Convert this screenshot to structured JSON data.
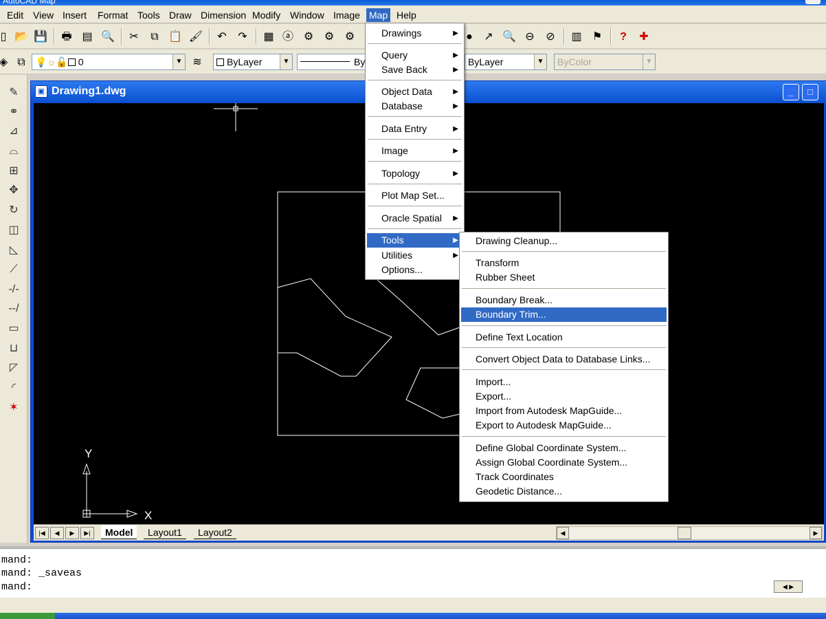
{
  "window": {
    "title": "AutoCAD Map"
  },
  "menubar": {
    "items": [
      "Edit",
      "View",
      "Insert",
      "Format",
      "Tools",
      "Draw",
      "Dimension",
      "Modify",
      "Window",
      "Image",
      "Map",
      "Help"
    ],
    "active": "Map"
  },
  "properties_toolbar": {
    "layer_value": "0",
    "color_value": "ByLayer",
    "linetype_value": "ByLayer",
    "lineweight_value": "ByLayer",
    "plotstyle_value": "ByColor"
  },
  "drawing": {
    "title": "Drawing1.dwg",
    "ucs": {
      "x_label": "X",
      "y_label": "Y"
    },
    "tabs": [
      "Model",
      "Layout1",
      "Layout2"
    ],
    "active_tab": "Model"
  },
  "command": {
    "lines": [
      "mand:",
      "mand: _saveas",
      "mand:"
    ]
  },
  "map_menu": {
    "items": [
      {
        "label": "Drawings",
        "submenu": true
      },
      {
        "label": "Query",
        "submenu": true
      },
      {
        "label": "Save Back",
        "submenu": true
      },
      {
        "label": "Object Data",
        "submenu": true
      },
      {
        "label": "Database",
        "submenu": true
      },
      {
        "label": "Data Entry",
        "submenu": true
      },
      {
        "label": "Image",
        "submenu": true
      },
      {
        "label": "Topology",
        "submenu": true
      },
      {
        "label": "Plot Map Set...",
        "submenu": false
      },
      {
        "label": "Oracle Spatial",
        "submenu": true
      },
      {
        "label": "Tools",
        "submenu": true,
        "highlighted": true
      },
      {
        "label": "Utilities",
        "submenu": true
      },
      {
        "label": "Options...",
        "submenu": false
      }
    ]
  },
  "tools_submenu": {
    "items": [
      {
        "label": "Drawing Cleanup..."
      },
      {
        "label": "Transform"
      },
      {
        "label": "Rubber Sheet"
      },
      {
        "label": "Boundary Break..."
      },
      {
        "label": "Boundary Trim...",
        "highlighted": true
      },
      {
        "label": "Define Text Location"
      },
      {
        "label": "Convert Object Data to Database Links..."
      },
      {
        "label": "Import..."
      },
      {
        "label": "Export..."
      },
      {
        "label": "Import from Autodesk MapGuide..."
      },
      {
        "label": "Export to Autodesk MapGuide..."
      },
      {
        "label": "Define Global Coordinate System..."
      },
      {
        "label": "Assign Global Coordinate System..."
      },
      {
        "label": "Track Coordinates"
      },
      {
        "label": "Geodetic Distance..."
      }
    ]
  },
  "icons": {
    "submenu_arrow": "▶",
    "combo_arrow": "▼"
  }
}
